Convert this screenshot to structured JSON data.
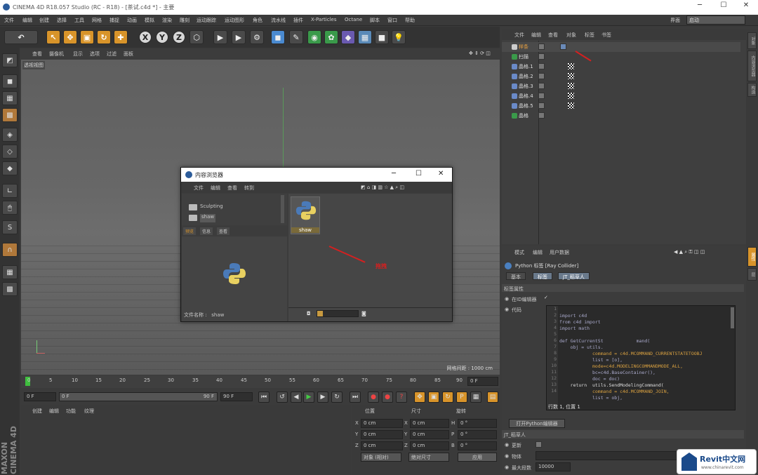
{
  "window": {
    "title": "CINEMA 4D R18.057 Studio (RC - R18) - [茶试.c4d *] - 主要"
  },
  "menu": [
    "文件",
    "编辑",
    "创建",
    "选择",
    "工具",
    "网格",
    "捕捉",
    "动画",
    "模拟",
    "渲染",
    "雕刻",
    "运动跟踪",
    "运动图形",
    "角色",
    "流水线",
    "插件",
    "X-Particles",
    "Octane",
    "脚本",
    "窗口",
    "帮助"
  ],
  "layout": {
    "label": "界面",
    "value": "启动"
  },
  "viewport": {
    "menu": [
      "查看",
      "摄像机",
      "显示",
      "选项",
      "过滤",
      "面板"
    ],
    "label": "透视视图",
    "grid_note": "网格间距 : 1000 cm"
  },
  "timeline": {
    "ticks": [
      "0",
      "5",
      "10",
      "15",
      "20",
      "25",
      "30",
      "35",
      "40",
      "45",
      "50",
      "55",
      "60",
      "65",
      "70",
      "75",
      "80",
      "85",
      "90"
    ],
    "frame_field": "0 F",
    "start": "0 F",
    "end": "90 F",
    "current": "0 F",
    "max": "90 F"
  },
  "materials": {
    "menu": [
      "创建",
      "编辑",
      "功能",
      "纹理"
    ]
  },
  "coords": {
    "headers": [
      "位置",
      "尺寸",
      "旋转"
    ],
    "rows": [
      {
        "axis": "X",
        "pos": "0 cm",
        "size": "0 cm",
        "rlabel": "H",
        "rot": "0 °"
      },
      {
        "axis": "Y",
        "pos": "0 cm",
        "size": "0 cm",
        "rlabel": "P",
        "rot": "0 °"
      },
      {
        "axis": "Z",
        "pos": "0 cm",
        "size": "0 cm",
        "rlabel": "B",
        "rot": "0 °"
      }
    ],
    "mode": "对象 (相对)",
    "size_mode": "绝对尺寸",
    "apply": "应用"
  },
  "objects": {
    "menu": [
      "文件",
      "编辑",
      "查看",
      "对象",
      "标签",
      "书签"
    ],
    "items": [
      "样条",
      "扫描",
      "晶格.1",
      "晶格.2",
      "晶格.3",
      "晶格.4",
      "晶格.5",
      "晶格"
    ]
  },
  "attributes": {
    "menu": [
      "模式",
      "编辑",
      "用户数据"
    ],
    "title": "Python 标签 [Ray Collider]",
    "tabs": [
      "基本",
      "标签",
      "JT_稻草人"
    ],
    "section": "标签属性",
    "editor_label": "在ID编辑器",
    "code_label": "代码",
    "code": [
      "import c4d",
      "from c4d import",
      "import math",
      "",
      "def GetCurrentSt            mand(",
      "    obj = utils.",
      "            command = c4d.MCOMMAND_CURRENTSTATETOOBJ",
      "            list = [o],",
      "            mode=c4d.MODELINGCOMMANDMODE_ALL,",
      "            bc=c4d.BaseContainer(),",
      "            doc = doc)",
      "    return  utils.SendModelingCommand(",
      "            command = c4d.MCOMMAND_JOIN,",
      "            list = obj,"
    ],
    "status": "行数 1, 位置 1",
    "open_button": "打开Python编辑器",
    "jt_label": "JT_稻草人",
    "update_label": "更新",
    "object_label": "物体",
    "max_label": "最大段数",
    "max_value": "10000"
  },
  "side_tabs": [
    "对象",
    "内容浏览器",
    "构造",
    "属性",
    "层"
  ],
  "dialog": {
    "title": "内容浏览器",
    "menu": [
      "文件",
      "编辑",
      "查看",
      "转到"
    ],
    "tree": [
      "Sculpting",
      "shaw"
    ],
    "tabs": [
      "预览",
      "信息",
      "查看"
    ],
    "file_label": "文件名称 :",
    "file_value": "shaw",
    "item": "shaw",
    "annotation": "拖拽"
  },
  "watermark": {
    "brand": "Revit中文网",
    "url": "www.chinarevit.com"
  },
  "colors": {
    "accent": "#d8942a",
    "arrow": "#d42020"
  }
}
